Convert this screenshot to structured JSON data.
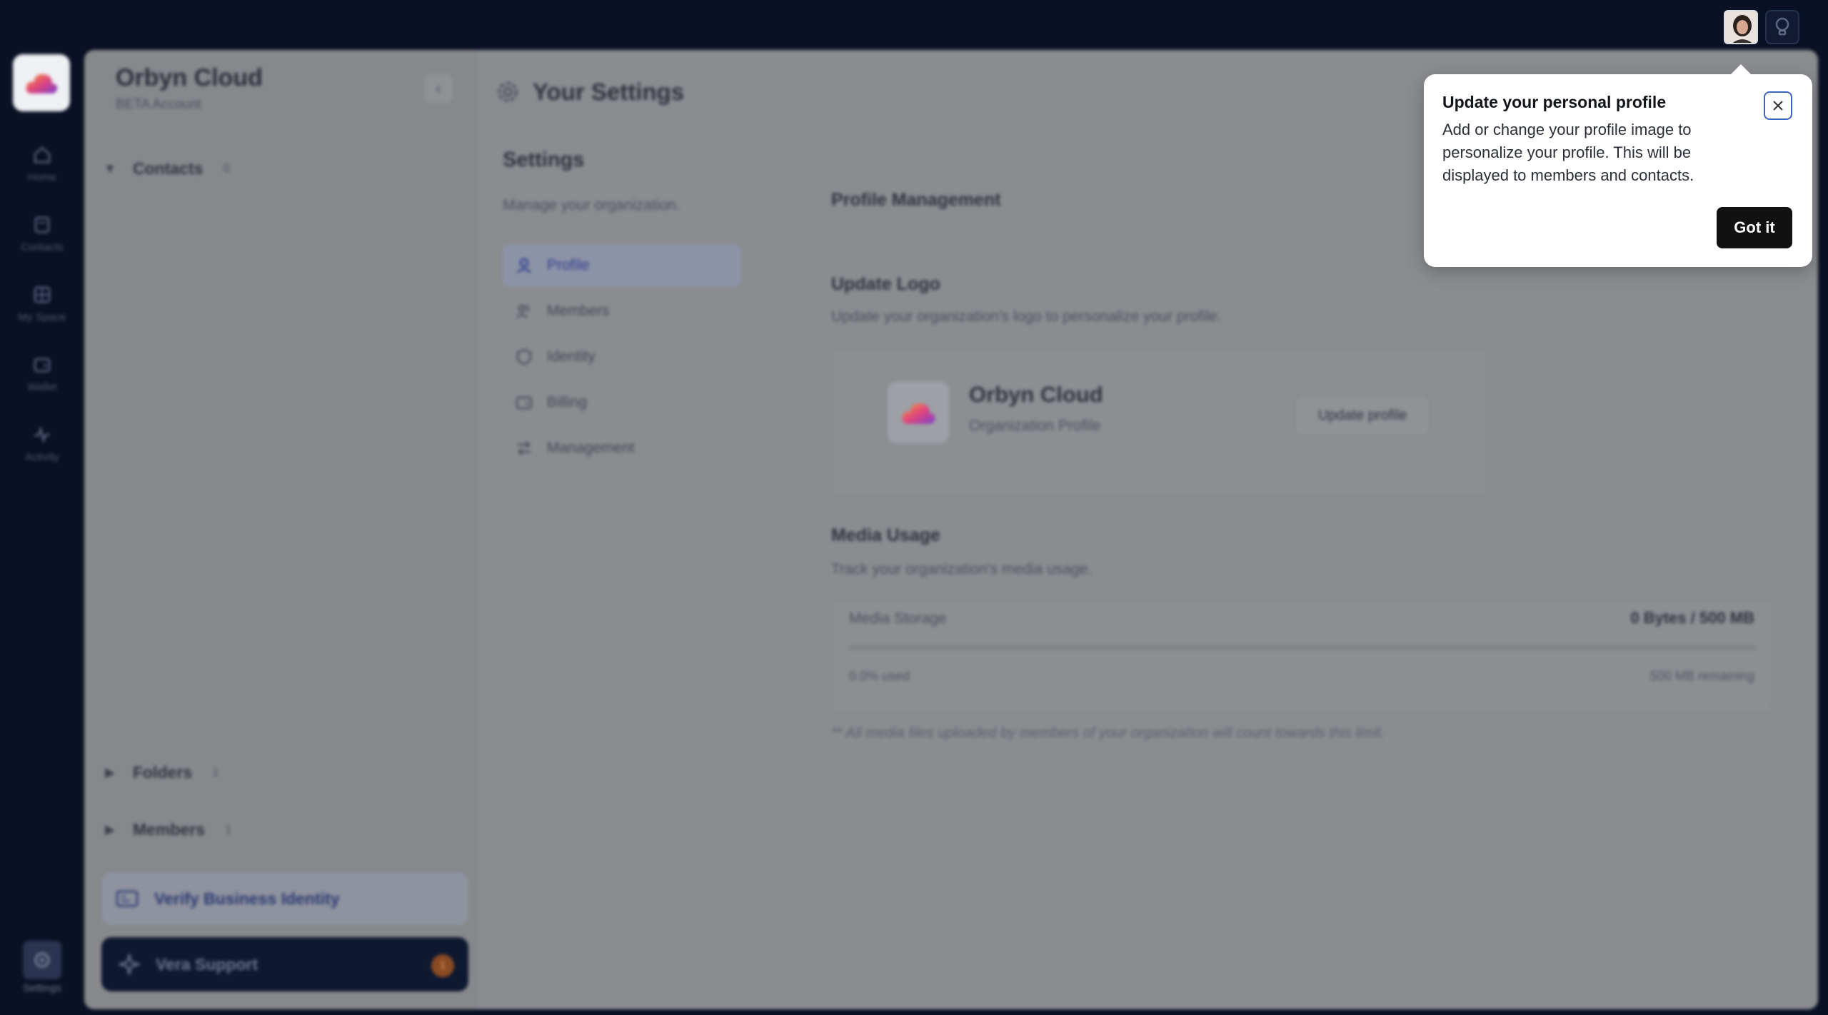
{
  "rail": {
    "items": [
      {
        "label": "Home",
        "icon": "home-icon"
      },
      {
        "label": "Contacts",
        "icon": "contacts-icon"
      },
      {
        "label": "My Space",
        "icon": "grid-icon"
      },
      {
        "label": "Wallet",
        "icon": "wallet-icon"
      },
      {
        "label": "Activity",
        "icon": "activity-icon"
      }
    ],
    "settings_label": "Settings"
  },
  "sidebar": {
    "org_name": "Orbyn Cloud",
    "org_sub": "BETA Account",
    "tree": [
      {
        "name": "Contacts",
        "count": "0",
        "caret": "▼"
      },
      {
        "name": "Folders",
        "count": "1",
        "caret": "▶"
      },
      {
        "name": "Members",
        "count": "1",
        "caret": "▶"
      }
    ],
    "verify_label": "Verify Business Identity",
    "support_label": "Vera Support",
    "support_badge": "1"
  },
  "page": {
    "title": "Your Settings",
    "settings_title": "Settings",
    "settings_sub": "Manage your organization.",
    "nav": [
      {
        "label": "Profile",
        "active": true
      },
      {
        "label": "Members",
        "active": false
      },
      {
        "label": "Identity",
        "active": false
      },
      {
        "label": "Billing",
        "active": false
      },
      {
        "label": "Management",
        "active": false
      }
    ]
  },
  "profile": {
    "heading": "Profile Management",
    "logo_title": "Update Logo",
    "logo_sub": "Update your organization's logo to personalize your profile.",
    "org_name": "Orbyn Cloud",
    "org_type": "Organization Profile",
    "update_button": "Update profile"
  },
  "media": {
    "title": "Media Usage",
    "sub": "Track your organization's media usage.",
    "storage_label": "Media Storage",
    "storage_value": "0 Bytes / 500 MB",
    "used": "0.0% used",
    "remaining": "500 MB remaining",
    "used_fraction": 0.0,
    "note": "** All media files uploaded by members of your organization will count towards this limit."
  },
  "tooltip": {
    "title": "Update your personal profile",
    "body": "Add or change your profile image to personalize your profile. This will be displayed to members and contacts.",
    "ok_label": "Got it"
  },
  "colors": {
    "background": "#0a1124",
    "accent": "#3a63c4",
    "button_dark": "#111111",
    "badge": "#8a4b23"
  }
}
